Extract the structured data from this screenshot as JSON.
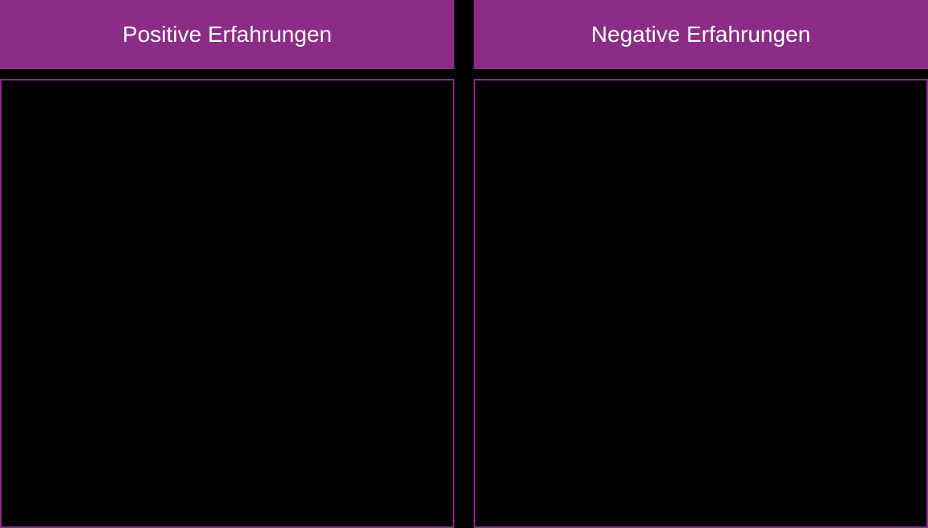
{
  "columns": {
    "left": {
      "header": "Positive Erfahrungen"
    },
    "right": {
      "header": "Negative Erfahrungen"
    }
  },
  "colors": {
    "accent": "#8B2C87",
    "background": "#000000",
    "headerText": "#ffffff"
  }
}
